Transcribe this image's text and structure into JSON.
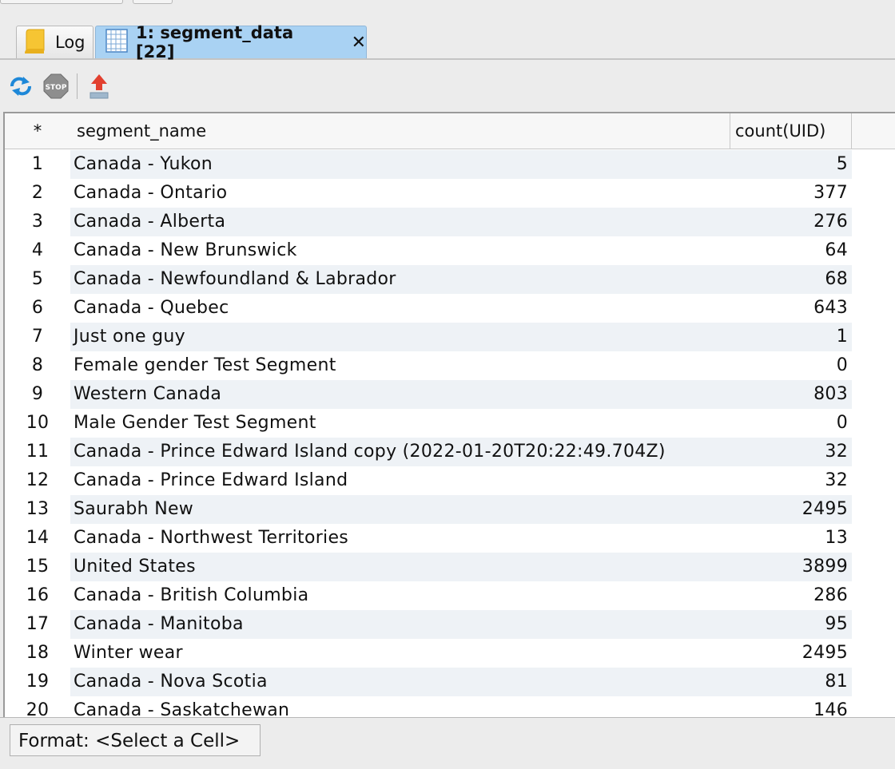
{
  "tabs": [
    {
      "label": "Log",
      "icon": "note-icon"
    },
    {
      "label": "1: segment_data [22]",
      "icon": "table-icon",
      "close": "✕"
    }
  ],
  "toolbar": {
    "buttons": [
      "refresh-icon",
      "stop-icon",
      "export-icon"
    ],
    "stop_text": "STOP"
  },
  "table": {
    "headers": {
      "corner": "*",
      "name": "segment_name",
      "count": "count(UID)"
    },
    "rows": [
      {
        "idx": "1",
        "name": "Canada - Yukon",
        "count": "5"
      },
      {
        "idx": "2",
        "name": "Canada - Ontario",
        "count": "377"
      },
      {
        "idx": "3",
        "name": "Canada - Alberta",
        "count": "276"
      },
      {
        "idx": "4",
        "name": "Canada - New Brunswick",
        "count": "64"
      },
      {
        "idx": "5",
        "name": "Canada - Newfoundland & Labrador",
        "count": "68"
      },
      {
        "idx": "6",
        "name": "Canada - Quebec",
        "count": "643"
      },
      {
        "idx": "7",
        "name": "Just one guy",
        "count": "1"
      },
      {
        "idx": "8",
        "name": "Female gender Test Segment",
        "count": "0"
      },
      {
        "idx": "9",
        "name": "Western Canada",
        "count": "803"
      },
      {
        "idx": "10",
        "name": "Male Gender Test Segment",
        "count": "0"
      },
      {
        "idx": "11",
        "name": "Canada - Prince Edward Island copy (2022-01-20T20:22:49.704Z)",
        "count": "32"
      },
      {
        "idx": "12",
        "name": "Canada - Prince Edward Island",
        "count": "32"
      },
      {
        "idx": "13",
        "name": "Saurabh New",
        "count": "2495"
      },
      {
        "idx": "14",
        "name": "Canada - Northwest Territories",
        "count": "13"
      },
      {
        "idx": "15",
        "name": "United States",
        "count": "3899"
      },
      {
        "idx": "16",
        "name": "Canada - British Columbia",
        "count": "286"
      },
      {
        "idx": "17",
        "name": "Canada - Manitoba",
        "count": "95"
      },
      {
        "idx": "18",
        "name": "Winter wear",
        "count": "2495"
      },
      {
        "idx": "19",
        "name": "Canada - Nova Scotia",
        "count": "81"
      },
      {
        "idx": "20",
        "name": "Canada - Saskatchewan",
        "count": "146"
      }
    ]
  },
  "status": {
    "format_label": "Format: <Select a Cell>"
  },
  "colors": {
    "active_tab": "#a9d2f3",
    "alt_row": "#eef2f6",
    "export_arrow": "#e2402f",
    "refresh": "#1e88d8"
  }
}
